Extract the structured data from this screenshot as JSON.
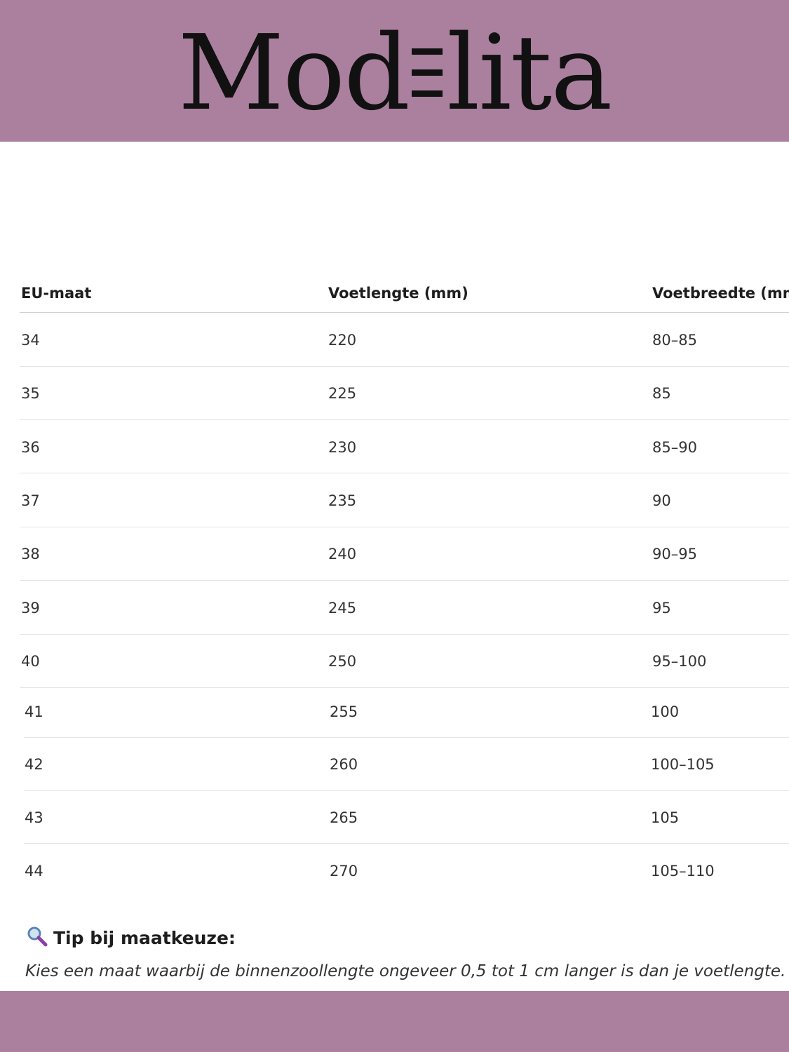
{
  "brand": {
    "logo_part1": "Mod",
    "logo_part2": "lita",
    "band_color": "#ab809f"
  },
  "table": {
    "headers": [
      "EU-maat",
      "Voetlengte (mm)",
      "Voetbreedte (mm)"
    ],
    "rows": [
      [
        "34",
        "220",
        "80–85"
      ],
      [
        "35",
        "225",
        "85"
      ],
      [
        "36",
        "230",
        "85–90"
      ],
      [
        "37",
        "235",
        "90"
      ],
      [
        "38",
        "240",
        "90–95"
      ],
      [
        "39",
        "245",
        "95"
      ],
      [
        "40",
        "250",
        "95–100"
      ],
      [
        "41",
        "255",
        "100"
      ],
      [
        "42",
        "260",
        "100–105"
      ],
      [
        "43",
        "265",
        "105"
      ],
      [
        "44",
        "270",
        "105–110"
      ]
    ]
  },
  "tip": {
    "icon": "magnifier-icon",
    "title": "Tip bij maatkeuze:",
    "text": "Kies een maat waarbij de binnenzoollengte ongeveer 0,5 tot 1 cm langer is dan je voetlengte."
  }
}
